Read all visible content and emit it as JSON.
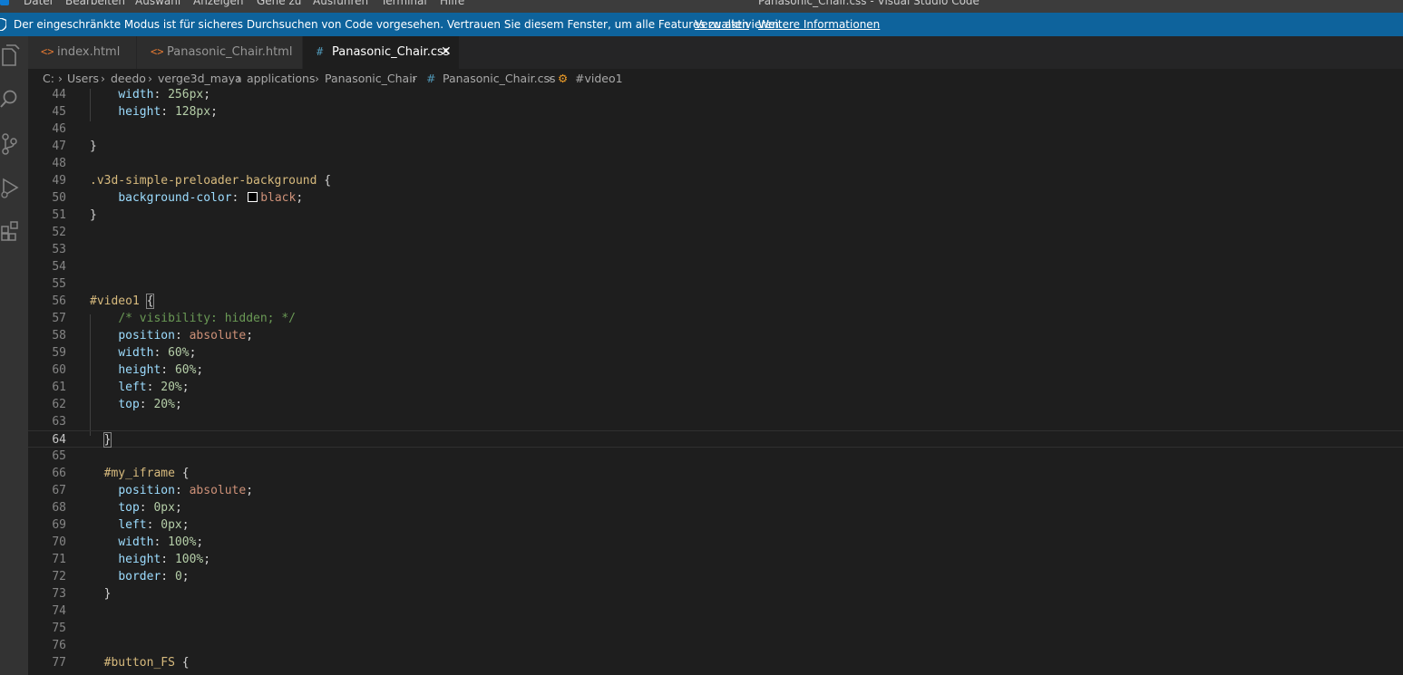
{
  "menu": {
    "items": [
      "Datei",
      "Bearbeiten",
      "Auswahl",
      "Anzeigen",
      "Gehe zu",
      "Ausführen",
      "Terminal",
      "Hilfe"
    ],
    "window_title": "Panasonic_Chair.css - Visual Studio Code"
  },
  "banner": {
    "message": "Der eingeschränkte Modus ist für sicheres Durchsuchen von Code vorgesehen. Vertrauen Sie diesem Fenster, um alle Features zu aktivieren.",
    "manage_link": "Verwalten",
    "more_info_link": "Weitere Informationen"
  },
  "activity_bar": [
    "explorer-icon",
    "search-icon",
    "source-control-icon",
    "run-debug-icon",
    "extensions-icon"
  ],
  "tabs": [
    {
      "label": "index.html",
      "icon": "html-file-icon",
      "icon_glyph": "<>",
      "active": false
    },
    {
      "label": "Panasonic_Chair.html",
      "icon": "html-file-icon",
      "icon_glyph": "<>",
      "active": false
    },
    {
      "label": "Panasonic_Chair.css",
      "icon": "css-file-icon",
      "icon_glyph": "#",
      "active": true,
      "close_glyph": "✕"
    }
  ],
  "breadcrumb": {
    "parts": [
      "C:",
      "Users",
      "deedo",
      "verge3d_maya",
      "applications",
      "Panasonic_Chair"
    ],
    "file_icon_glyph": "#",
    "file": "Panasonic_Chair.css",
    "symbol": "#video1"
  },
  "editor": {
    "current_line": 64,
    "lines": [
      {
        "n": 44,
        "code": "    width: 256px;"
      },
      {
        "n": 45,
        "code": "    height: 128px;"
      },
      {
        "n": 46,
        "code": ""
      },
      {
        "n": 47,
        "code": "}"
      },
      {
        "n": 48,
        "code": ""
      },
      {
        "n": 49,
        "code": ".v3d-simple-preloader-background {"
      },
      {
        "n": 50,
        "code": "    background-color: black;"
      },
      {
        "n": 51,
        "code": "}"
      },
      {
        "n": 52,
        "code": ""
      },
      {
        "n": 53,
        "code": ""
      },
      {
        "n": 54,
        "code": ""
      },
      {
        "n": 55,
        "code": ""
      },
      {
        "n": 56,
        "code": "#video1 {"
      },
      {
        "n": 57,
        "code": "    /* visibility: hidden; */"
      },
      {
        "n": 58,
        "code": "    position: absolute;"
      },
      {
        "n": 59,
        "code": "    width: 60%;"
      },
      {
        "n": 60,
        "code": "    height: 60%;"
      },
      {
        "n": 61,
        "code": "    left: 20%;"
      },
      {
        "n": 62,
        "code": "    top: 20%;"
      },
      {
        "n": 63,
        "code": ""
      },
      {
        "n": 64,
        "code": "  }"
      },
      {
        "n": 65,
        "code": ""
      },
      {
        "n": 66,
        "code": "  #my_iframe {"
      },
      {
        "n": 67,
        "code": "    position: absolute;"
      },
      {
        "n": 68,
        "code": "    top: 0px;"
      },
      {
        "n": 69,
        "code": "    left: 0px;"
      },
      {
        "n": 70,
        "code": "    width: 100%;"
      },
      {
        "n": 71,
        "code": "    height: 100%;"
      },
      {
        "n": 72,
        "code": "    border: 0;"
      },
      {
        "n": 73,
        "code": "  }"
      },
      {
        "n": 74,
        "code": ""
      },
      {
        "n": 75,
        "code": ""
      },
      {
        "n": 76,
        "code": ""
      },
      {
        "n": 77,
        "code": "  #button_FS {"
      }
    ]
  },
  "colors": {
    "banner_bg": "#0e639c",
    "editor_bg": "#1e1e1e",
    "selector": "#d7ba7d",
    "property": "#9cdcfe",
    "number": "#b5cea8",
    "keyword_value": "#ce9178",
    "comment": "#6a9955"
  }
}
